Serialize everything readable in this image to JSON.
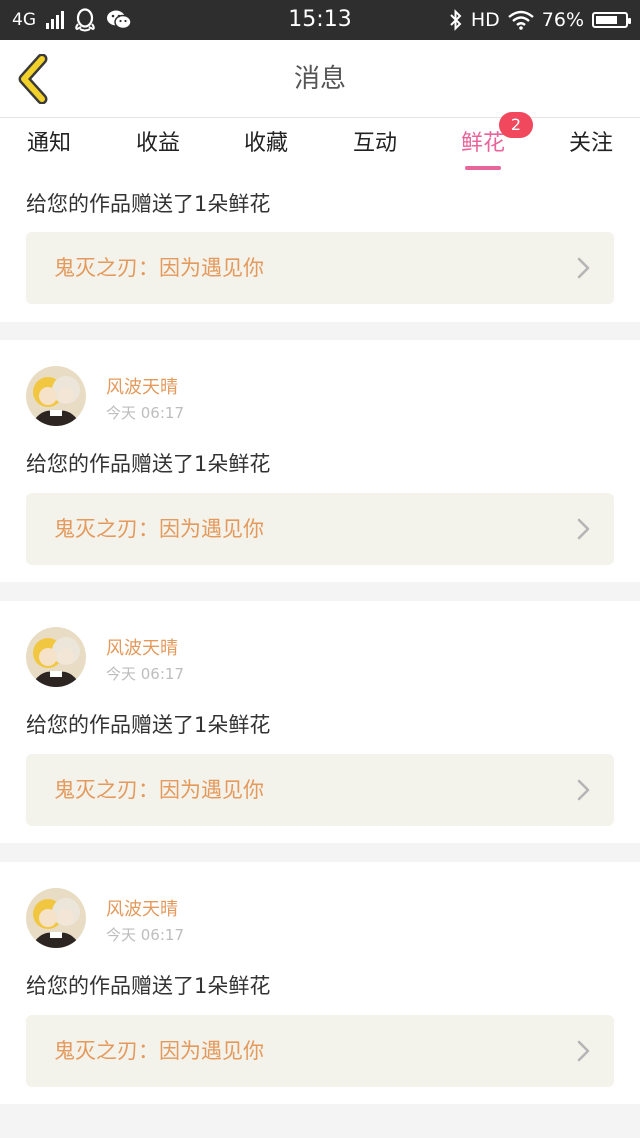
{
  "status_bar": {
    "network": "4G",
    "time": "15:13",
    "hd": "HD",
    "battery": "76%",
    "battery_level": 0.76
  },
  "header": {
    "title": "消息"
  },
  "tabs": [
    {
      "label": "通知"
    },
    {
      "label": "收益"
    },
    {
      "label": "收藏"
    },
    {
      "label": "互动"
    },
    {
      "label": "鲜花",
      "badge": "2",
      "active": true
    },
    {
      "label": "关注"
    }
  ],
  "feed": {
    "partial_item": {
      "message": "给您的作品赠送了1朵鲜花",
      "work_title": "鬼灭之刃：因为遇见你"
    },
    "items": [
      {
        "user_name": "风波天晴",
        "time": "今天 06:17",
        "message": "给您的作品赠送了1朵鲜花",
        "work_title": "鬼灭之刃：因为遇见你"
      },
      {
        "user_name": "风波天晴",
        "time": "今天 06:17",
        "message": "给您的作品赠送了1朵鲜花",
        "work_title": "鬼灭之刃：因为遇见你"
      },
      {
        "user_name": "风波天晴",
        "time": "今天 06:17",
        "message": "给您的作品赠送了1朵鲜花",
        "work_title": "鬼灭之刃：因为遇见你"
      }
    ]
  },
  "colors": {
    "accent_pink": "#e8649a",
    "badge_red": "#f2485d",
    "name_orange": "#e49a5c",
    "back_arrow_yellow": "#f2d12a"
  }
}
